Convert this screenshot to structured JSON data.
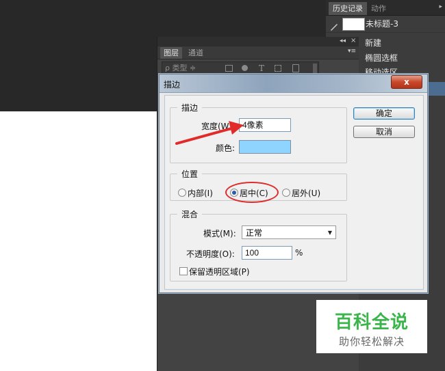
{
  "history_panel": {
    "tabs": [
      "历史记录",
      "动作"
    ],
    "snapshot": "未标题-3",
    "items": [
      "新建",
      "椭圆选框",
      "移动选区"
    ]
  },
  "layers_panel": {
    "tabs": [
      "图层",
      "通道"
    ],
    "filter": "ρ 类型 ≑",
    "filter_icons": [
      "image-filter-icon",
      "adjustment-filter-icon",
      "text-filter-icon",
      "shape-filter-icon",
      "smart-object-filter-icon"
    ]
  },
  "dialog": {
    "title": "描边",
    "close_label": "x",
    "stroke": {
      "legend": "描边",
      "width_label": "宽度(W):",
      "width_value": "4像素",
      "color_label": "颜色:",
      "color_value": "#8fd3ff"
    },
    "position": {
      "legend": "位置",
      "options": [
        "内部(I)",
        "居中(C)",
        "居外(U)"
      ],
      "selected": "居中(C)"
    },
    "blend": {
      "legend": "混合",
      "mode_label": "模式(M):",
      "mode_value": "正常",
      "opacity_label": "不透明度(O):",
      "opacity_value": "100",
      "opacity_unit": "%",
      "preserve_label": "保留透明区域(P)",
      "preserve_checked": false
    },
    "ok_label": "确定",
    "cancel_label": "取消"
  },
  "annotations": {
    "arrow_color": "#e12a2a",
    "circle_color": "#e12a2a"
  },
  "watermark": {
    "title": "百科全说",
    "subtitle": "助你轻松解决",
    "title_color": "#3ab54a"
  }
}
